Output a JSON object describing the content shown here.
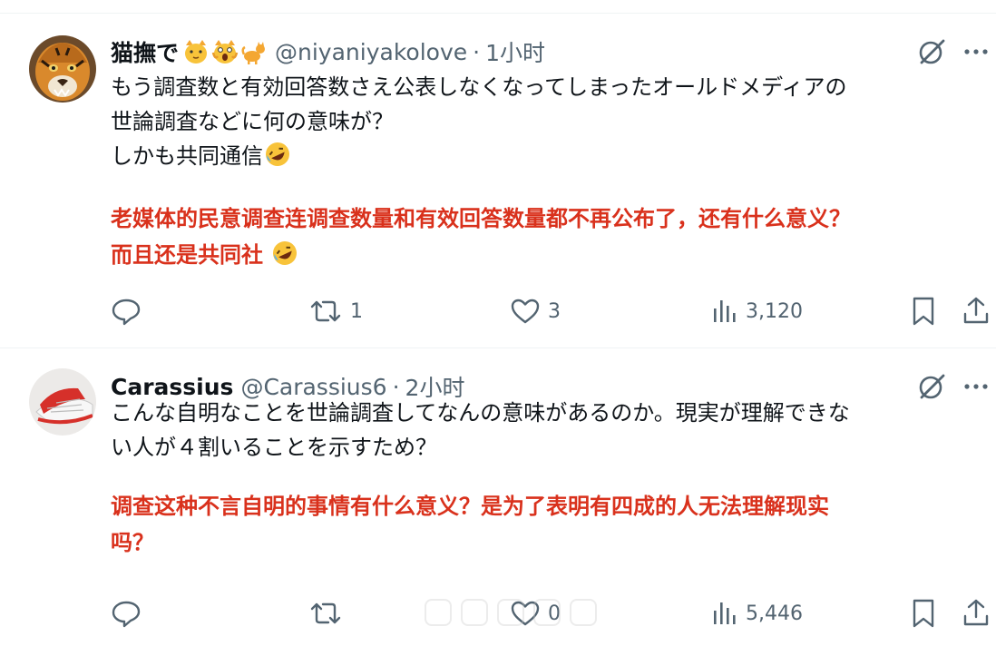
{
  "tweets": [
    {
      "name": "猫撫で",
      "handle": "@niyaniyakolove",
      "sep": "·",
      "time": "1小时",
      "jp_lines": [
        "もう調査数と有効回答数さえ公表しなくなってしまったオールドメディアの",
        "世論調査などに何の意味が？",
        "しかも共同通信"
      ],
      "cn_lines": [
        "老媒体的民意调查连调查数量和有效回答数量都不再公布了，还有什么意义？",
        "而且还是共同社 "
      ],
      "counts": {
        "reply": "",
        "retweet": "1",
        "like": "3",
        "views": "3,120"
      },
      "icons": {
        "name_emojis": [
          "cat-face-emoji",
          "screaming-cat-emoji",
          "cat-emoji"
        ],
        "body_emoji": "rolling-laughing-emoji"
      }
    },
    {
      "name": "Carassius",
      "handle": "@Carassius6",
      "sep": "·",
      "time": "2小时",
      "jp_lines": [
        "こんな自明なことを世論調査してなんの意味があるのか。現実が理解できな",
        "い人が４割いることを示すため？"
      ],
      "cn_lines": [
        "调查这种不言自明的事情有什么意义？是为了表明有四成的人无法理解现实",
        "吗？"
      ],
      "counts": {
        "reply": "",
        "retweet": "",
        "like": "0",
        "views": "5,446"
      }
    }
  ],
  "colors": {
    "translation": "#d9311c",
    "secondary": "#536471",
    "divider": "#eff3f4"
  }
}
